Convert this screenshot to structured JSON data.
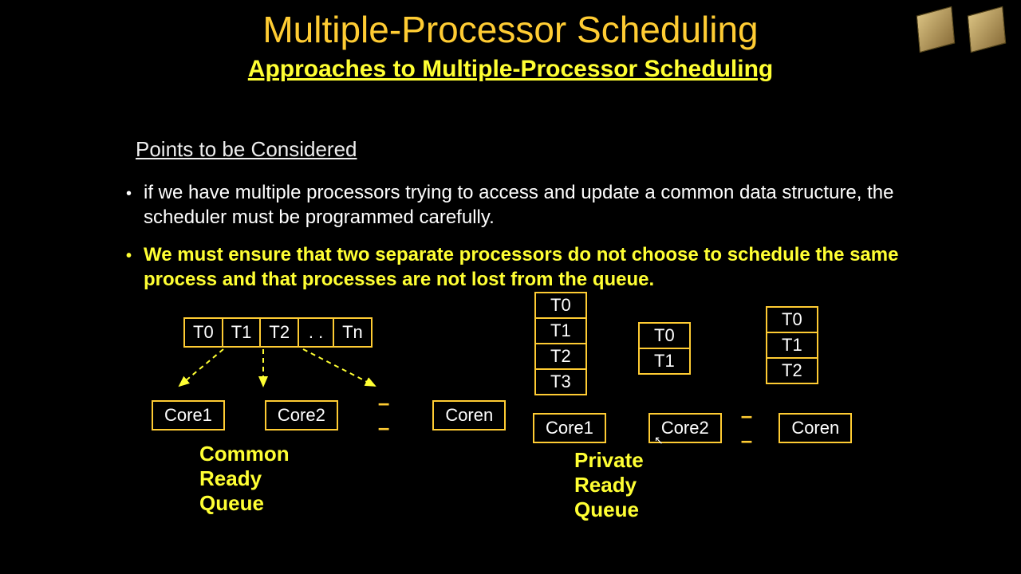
{
  "title": "Multiple-Processor Scheduling",
  "subtitle": "Approaches to Multiple-Processor Scheduling",
  "section_heading": "Points to be Considered",
  "bullets": [
    "if we have multiple processors trying to access and update a common data structure, the scheduler must be programmed carefully.",
    "We must ensure that two separate processors do not choose to schedule the same process and that processes are not lost from the queue."
  ],
  "common_queue": {
    "items": [
      "T0",
      "T1",
      "T2",
      ". .",
      "Tn"
    ],
    "cores": [
      "Core1",
      "Core2",
      "Coren"
    ],
    "label": "Common Ready Queue",
    "separator": "– –"
  },
  "private_queue": {
    "stacks": [
      [
        "T0",
        "T1",
        "T2",
        "T3"
      ],
      [
        "T0",
        "T1"
      ],
      [
        "T0",
        "T1",
        "T2"
      ]
    ],
    "cores": [
      "Core1",
      "Core2",
      "Coren"
    ],
    "label": "Private Ready Queue",
    "separator": "– –"
  }
}
